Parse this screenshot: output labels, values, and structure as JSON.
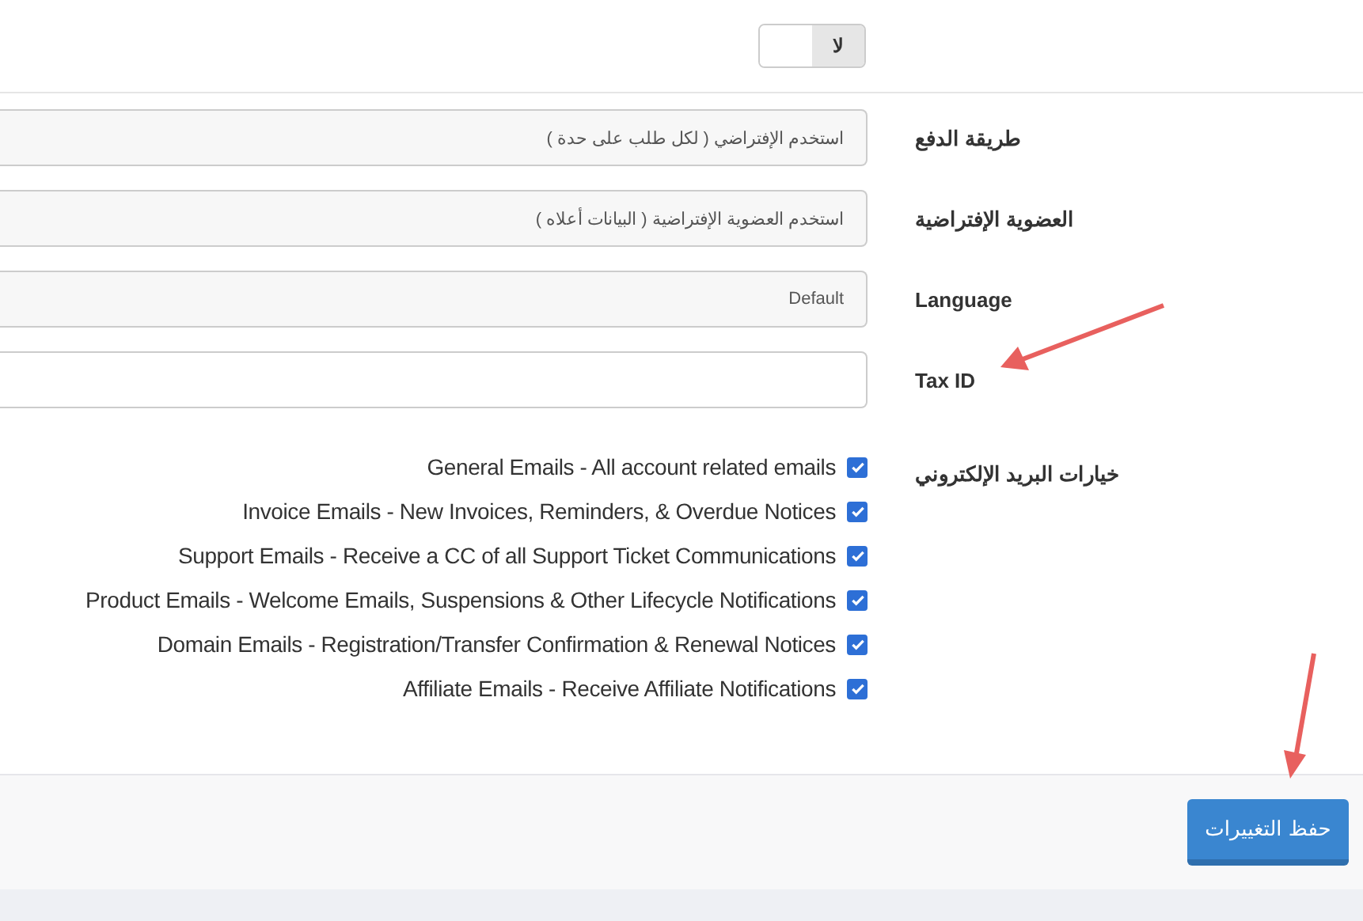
{
  "toggle": {
    "label": "لا",
    "on": false
  },
  "fields": [
    {
      "label": "طريقة الدفع",
      "value": "استخدم الإفتراضي ( لكل طلب على حدة )"
    },
    {
      "label": "العضوية الإفتراضية",
      "value": "استخدم العضوية الإفتراضية ( البيانات أعلاه )"
    },
    {
      "label": "Language",
      "value": "Default"
    },
    {
      "label": "Tax ID"
    }
  ],
  "email_preferences": {
    "label": "خيارات البريد الإلكتروني",
    "options": [
      {
        "text": "General Emails - All account related emails",
        "checked": true
      },
      {
        "text": "Invoice Emails - New Invoices, Reminders, & Overdue Notices",
        "checked": true
      },
      {
        "text": "Support Emails - Receive a CC of all Support Ticket Communications",
        "checked": true
      },
      {
        "text": "Product Emails - Welcome Emails, Suspensions & Other Lifecycle Notifications",
        "checked": true
      },
      {
        "text": "Domain Emails - Registration/Transfer Confirmation & Renewal Notices",
        "checked": true
      },
      {
        "text": "Affiliate Emails - Receive Affiliate Notifications",
        "checked": true
      }
    ]
  },
  "save_button": "حفظ التغييرات"
}
